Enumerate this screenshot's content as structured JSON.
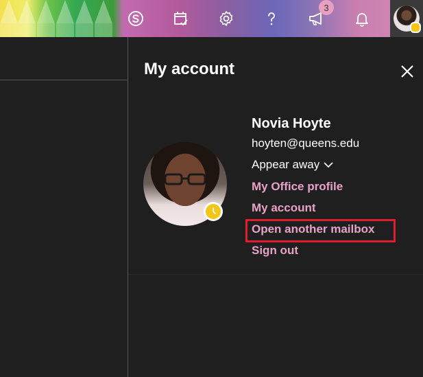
{
  "header": {
    "notification_count": "3",
    "icons": [
      "skype-icon",
      "calendar-check-icon",
      "gear-icon",
      "help-icon",
      "megaphone-icon",
      "bell-icon"
    ],
    "accent": "#e8a2c7"
  },
  "panel": {
    "title": "My account",
    "user": {
      "name": "Novia Hoyte",
      "email": "hoyten@queens.edu",
      "presence": "Appear away"
    },
    "links": [
      {
        "label": "My Office profile"
      },
      {
        "label": "My account"
      },
      {
        "label": "Open another mailbox"
      },
      {
        "label": "Sign out"
      }
    ],
    "highlight_color": "#e01e2b",
    "status_color": "#f5c518"
  }
}
